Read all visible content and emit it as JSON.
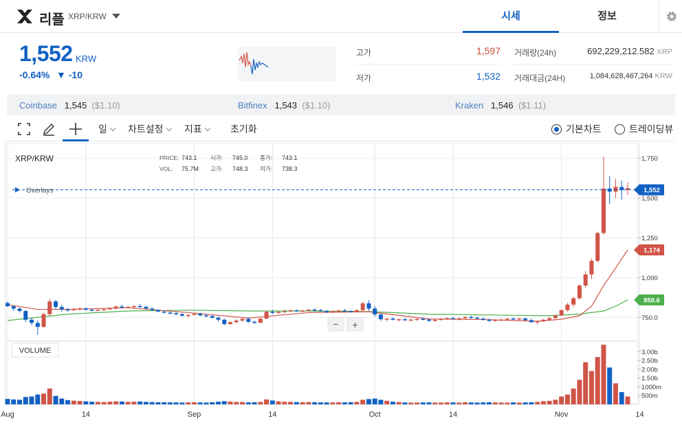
{
  "header": {
    "coin_name": "리플",
    "pair": "XRP/KRW",
    "tabs": [
      {
        "label": "시세",
        "active": true
      },
      {
        "label": "정보",
        "active": false
      }
    ],
    "icons": {
      "logo": "xrp-logo-icon",
      "dropdown": "chevron-down-icon",
      "settings": "gear-icon"
    }
  },
  "price": {
    "current": "1,552",
    "unit": "KRW",
    "change_pct": "-0.64%",
    "change_abs": "▼ -10",
    "color": "#1261c4"
  },
  "stats": {
    "high_label": "고가",
    "high": "1,597",
    "high_color": "#c84a31",
    "low_label": "저가",
    "low": "1,532",
    "low_color": "#1261c4",
    "volume_label": "거래량(24h)",
    "volume": "692,229,212.582",
    "volume_unit": "XRP",
    "value_label": "거래대금(24H)",
    "value": "1,084,628,467,264",
    "value_unit": "KRW"
  },
  "exchanges": [
    {
      "name": "Coinbase",
      "price": "1,545",
      "usd": "($1.10)"
    },
    {
      "name": "Bitfinex",
      "price": "1,543",
      "usd": "($1.10)"
    },
    {
      "name": "Kraken",
      "price": "1,546",
      "usd": "($1.11)"
    }
  ],
  "toolbar": {
    "period": "일",
    "chart_settings": "차트설정",
    "indicators": "지표",
    "reset": "초기화",
    "basic_chart": "기본차트",
    "trading_view": "트레이딩뷰",
    "icons": [
      "fullscreen-icon",
      "pencil-icon",
      "crosshair-icon"
    ]
  },
  "chart_data": {
    "type": "candlestick",
    "symbol": "XRP/KRW",
    "legend": {
      "price_label": "PRICE:",
      "price": "743.1",
      "open_label": "시가:",
      "open": "745.0",
      "close_label": "종가:",
      "close": "743.1",
      "vol_label": "VOL:",
      "vol": "75.7M",
      "high_label": "고가:",
      "high": "748.3",
      "low_label": "저가:",
      "low": "738.3"
    },
    "overlays_label": "Overlays",
    "volume_label": "VOLUME",
    "zoom_out": "−",
    "zoom_in": "+",
    "price_ticks": [
      "1,750",
      "1,500",
      "1,250",
      "1,000",
      "750.0"
    ],
    "price_tick_values": [
      1750,
      1500,
      1250,
      1000,
      750
    ],
    "ylim": [
      600,
      1800
    ],
    "volume_ticks": [
      "3.00b",
      "2.50b",
      "2.00b",
      "1.50b",
      "1000m",
      "500m"
    ],
    "volume_tick_values": [
      3000,
      2500,
      2000,
      1500,
      1000,
      500
    ],
    "volume_ylim": [
      0,
      3600
    ],
    "x_ticks": [
      {
        "label": "Aug",
        "index": 0
      },
      {
        "label": "14",
        "index": 13
      },
      {
        "label": "Sep",
        "index": 31
      },
      {
        "label": "14",
        "index": 44
      },
      {
        "label": "Oct",
        "index": 61
      },
      {
        "label": "14",
        "index": 74
      },
      {
        "label": "Nov",
        "index": 92
      },
      {
        "label": "14",
        "index": 105
      }
    ],
    "price_tags": [
      {
        "label": "1,552",
        "value": 1552,
        "color": "#1261c4"
      },
      {
        "label": "1,174",
        "value": 1174,
        "color": "#d05447"
      },
      {
        "label": "859.6",
        "value": 859.6,
        "color": "#4cae4c"
      }
    ],
    "up_color": "#d05447",
    "down_color": "#1261c4",
    "candles": [
      [
        0,
        840,
        850,
        815,
        820,
        310
      ],
      [
        1,
        820,
        825,
        790,
        805,
        280
      ],
      [
        2,
        805,
        812,
        780,
        790,
        260
      ],
      [
        3,
        790,
        795,
        720,
        735,
        420
      ],
      [
        4,
        735,
        745,
        700,
        715,
        450
      ],
      [
        5,
        715,
        730,
        640,
        690,
        560
      ],
      [
        6,
        690,
        780,
        685,
        770,
        610
      ],
      [
        7,
        770,
        865,
        760,
        850,
        900
      ],
      [
        8,
        850,
        860,
        800,
        815,
        480
      ],
      [
        9,
        815,
        830,
        785,
        800,
        330
      ],
      [
        10,
        800,
        810,
        785,
        795,
        240
      ],
      [
        11,
        795,
        810,
        790,
        802,
        210
      ],
      [
        12,
        802,
        815,
        792,
        806,
        190
      ],
      [
        13,
        806,
        812,
        792,
        798,
        170
      ],
      [
        14,
        798,
        805,
        788,
        795,
        150
      ],
      [
        15,
        795,
        805,
        790,
        797,
        140
      ],
      [
        16,
        797,
        806,
        793,
        800,
        130
      ],
      [
        17,
        800,
        812,
        795,
        808,
        150
      ],
      [
        18,
        808,
        825,
        800,
        818,
        170
      ],
      [
        19,
        818,
        830,
        808,
        812,
        160
      ],
      [
        20,
        812,
        822,
        806,
        815,
        140
      ],
      [
        21,
        815,
        828,
        810,
        820,
        150
      ],
      [
        22,
        820,
        835,
        812,
        816,
        160
      ],
      [
        23,
        816,
        822,
        800,
        805,
        140
      ],
      [
        24,
        805,
        812,
        790,
        796,
        130
      ],
      [
        25,
        796,
        800,
        782,
        786,
        120
      ],
      [
        26,
        786,
        794,
        775,
        780,
        120
      ],
      [
        27,
        780,
        788,
        770,
        775,
        110
      ],
      [
        28,
        775,
        784,
        765,
        770,
        110
      ],
      [
        29,
        770,
        776,
        755,
        760,
        100
      ],
      [
        30,
        760,
        770,
        750,
        765,
        110
      ],
      [
        31,
        765,
        778,
        760,
        772,
        120
      ],
      [
        32,
        772,
        780,
        758,
        762,
        110
      ],
      [
        33,
        762,
        770,
        752,
        758,
        100
      ],
      [
        34,
        758,
        764,
        742,
        748,
        120
      ],
      [
        35,
        748,
        755,
        725,
        735,
        150
      ],
      [
        36,
        735,
        742,
        700,
        708,
        180
      ],
      [
        37,
        708,
        725,
        700,
        720,
        160
      ],
      [
        38,
        720,
        738,
        712,
        730,
        140
      ],
      [
        39,
        730,
        745,
        722,
        740,
        130
      ],
      [
        40,
        740,
        748,
        715,
        722,
        110
      ],
      [
        41,
        722,
        730,
        708,
        716,
        120
      ],
      [
        42,
        716,
        745,
        712,
        742,
        140
      ],
      [
        43,
        742,
        790,
        738,
        785,
        280
      ],
      [
        44,
        785,
        798,
        770,
        778,
        220
      ],
      [
        45,
        778,
        790,
        770,
        785,
        170
      ],
      [
        46,
        785,
        795,
        778,
        789,
        150
      ],
      [
        47,
        789,
        800,
        782,
        794,
        140
      ],
      [
        48,
        794,
        800,
        785,
        790,
        130
      ],
      [
        49,
        790,
        798,
        784,
        792,
        120
      ],
      [
        50,
        792,
        802,
        788,
        798,
        130
      ],
      [
        51,
        798,
        808,
        790,
        795,
        120
      ],
      [
        52,
        795,
        803,
        787,
        790,
        110
      ],
      [
        53,
        790,
        796,
        778,
        782,
        110
      ],
      [
        54,
        782,
        792,
        776,
        789,
        110
      ],
      [
        55,
        789,
        798,
        783,
        793,
        120
      ],
      [
        56,
        793,
        802,
        786,
        789,
        110
      ],
      [
        57,
        789,
        796,
        780,
        786,
        120
      ],
      [
        58,
        786,
        800,
        782,
        795,
        140
      ],
      [
        59,
        795,
        850,
        790,
        838,
        260
      ],
      [
        60,
        838,
        858,
        790,
        805,
        300
      ],
      [
        61,
        805,
        822,
        755,
        768,
        330
      ],
      [
        62,
        768,
        775,
        728,
        738,
        260
      ],
      [
        63,
        738,
        745,
        725,
        742,
        200
      ],
      [
        64,
        742,
        750,
        730,
        735,
        150
      ],
      [
        65,
        735,
        742,
        726,
        738,
        130
      ],
      [
        66,
        738,
        745,
        728,
        732,
        110
      ],
      [
        67,
        732,
        740,
        725,
        736,
        100
      ],
      [
        68,
        736,
        744,
        728,
        740,
        100
      ],
      [
        69,
        740,
        748,
        732,
        736,
        110
      ],
      [
        70,
        736,
        742,
        722,
        728,
        110
      ],
      [
        71,
        728,
        738,
        722,
        734,
        100
      ],
      [
        72,
        734,
        745,
        729,
        741,
        100
      ],
      [
        73,
        741,
        750,
        735,
        745,
        110
      ],
      [
        74,
        745,
        752,
        736,
        740,
        110
      ],
      [
        75,
        740,
        748,
        730,
        744,
        100
      ],
      [
        76,
        744,
        758,
        740,
        752,
        120
      ],
      [
        77,
        752,
        760,
        742,
        748,
        110
      ],
      [
        78,
        748,
        755,
        738,
        742,
        100
      ],
      [
        79,
        742,
        748,
        730,
        735,
        110
      ],
      [
        80,
        735,
        742,
        722,
        728,
        120
      ],
      [
        81,
        728,
        738,
        722,
        734,
        110
      ],
      [
        82,
        734,
        742,
        726,
        736,
        100
      ],
      [
        83,
        736,
        745,
        730,
        742,
        100
      ],
      [
        84,
        742,
        750,
        735,
        738,
        110
      ],
      [
        85,
        738,
        746,
        730,
        743,
        100
      ],
      [
        86,
        743,
        748,
        728,
        732,
        110
      ],
      [
        87,
        732,
        740,
        715,
        720,
        120
      ],
      [
        88,
        720,
        730,
        705,
        725,
        140
      ],
      [
        89,
        725,
        740,
        720,
        735,
        180
      ],
      [
        90,
        735,
        748,
        728,
        745,
        200
      ],
      [
        91,
        745,
        765,
        740,
        762,
        260
      ],
      [
        92,
        762,
        800,
        755,
        795,
        450
      ],
      [
        93,
        795,
        840,
        785,
        830,
        560
      ],
      [
        94,
        830,
        880,
        815,
        870,
        900
      ],
      [
        95,
        870,
        960,
        860,
        950,
        1400
      ],
      [
        96,
        950,
        1040,
        935,
        1020,
        2400
      ],
      [
        97,
        1020,
        1120,
        990,
        1105,
        1900
      ],
      [
        98,
        1105,
        1290,
        1095,
        1280,
        2700
      ],
      [
        99,
        1280,
        1760,
        1270,
        1560,
        3400
      ],
      [
        100,
        1560,
        1640,
        1460,
        1540,
        2100
      ],
      [
        101,
        1540,
        1620,
        1500,
        1570,
        1200
      ],
      [
        102,
        1570,
        1610,
        1490,
        1550,
        700
      ],
      [
        103,
        1550,
        1600,
        1520,
        1562,
        450
      ]
    ],
    "ma_red": [
      [
        0,
        830
      ],
      [
        5,
        800
      ],
      [
        10,
        800
      ],
      [
        20,
        810
      ],
      [
        30,
        780
      ],
      [
        40,
        745
      ],
      [
        50,
        780
      ],
      [
        60,
        785
      ],
      [
        70,
        740
      ],
      [
        80,
        735
      ],
      [
        88,
        725
      ],
      [
        92,
        738
      ],
      [
        95,
        760
      ],
      [
        97,
        820
      ],
      [
        99,
        950
      ],
      [
        101,
        1060
      ],
      [
        103,
        1174
      ]
    ],
    "ma_green": [
      [
        0,
        730
      ],
      [
        10,
        770
      ],
      [
        20,
        790
      ],
      [
        30,
        795
      ],
      [
        40,
        790
      ],
      [
        50,
        790
      ],
      [
        60,
        786
      ],
      [
        70,
        770
      ],
      [
        80,
        765
      ],
      [
        90,
        760
      ],
      [
        95,
        770
      ],
      [
        99,
        790
      ],
      [
        101,
        820
      ],
      [
        103,
        859.6
      ]
    ]
  }
}
